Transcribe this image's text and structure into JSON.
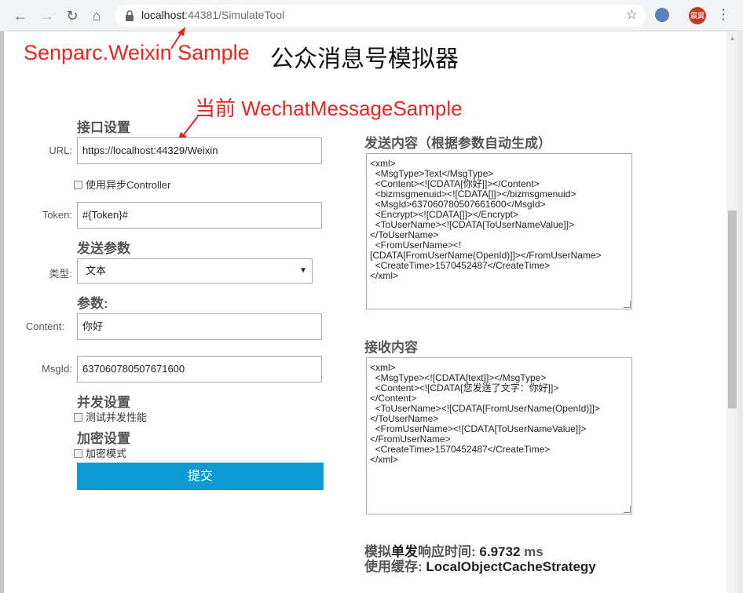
{
  "browser": {
    "url_host": "localhost",
    "url_port_path": ":44381/SimulateTool",
    "avatar_text": "震翼"
  },
  "annotations": {
    "sample": "Senparc.Weixin Sample",
    "current": "当前 WechatMessageSample"
  },
  "page": {
    "title": "公众消息号模拟器"
  },
  "form": {
    "interface_heading": "接口设置",
    "url_label": "URL:",
    "url_value": "https://localhost:44329/Weixin",
    "async_label": "使用异步Controller",
    "token_label": "Token:",
    "token_value": "#{Token}#",
    "send_params_heading": "发送参数",
    "type_label": "类型:",
    "type_value": "文本",
    "params_heading": "参数:",
    "content_label": "Content:",
    "content_value": "你好",
    "msgid_label": "MsgId:",
    "msgid_value": "637060780507671600",
    "concurrency_heading": "并发设置",
    "concurrency_check": "测试并发性能",
    "encrypt_heading": "加密设置",
    "encrypt_check": "加密模式",
    "submit_label": "提交"
  },
  "send": {
    "heading": "发送内容（根据参数自动生成）",
    "xml": "<xml>\n  <MsgType>Text</MsgType>\n  <Content><![CDATA[你好]]></Content>\n  <bizmsgmenuid><![CDATA[]]></bizmsgmenuid>\n  <MsgId>637060780507661600</MsgId>\n  <Encrypt><![CDATA[]]></Encrypt>\n  <ToUserName><![CDATA[ToUserNameValue]]>\n</ToUserName>\n  <FromUserName><!\n[CDATA[FromUserName(OpenId)]]></FromUserName>\n  <CreateTime>1570452487</CreateTime>\n</xml>"
  },
  "receive": {
    "heading": "接收内容",
    "xml": "<xml>\n  <MsgType><![CDATA[text]]></MsgType>\n  <Content><![CDATA[您发送了文字：你好]]>\n</Content>\n  <ToUserName><![CDATA[FromUserName(OpenId)]]>\n</ToUserName>\n  <FromUserName><![CDATA[ToUserNameValue]]>\n</FromUserName>\n  <CreateTime>1570452487</CreateTime>\n</xml>"
  },
  "stats": {
    "response_label_1": "模拟",
    "response_label_2": "单发",
    "response_label_3": "响应时间:",
    "response_value": "6.9732",
    "response_unit": "ms",
    "cache_label": "使用缓存:",
    "cache_value": "LocalObjectCacheStrategy"
  }
}
